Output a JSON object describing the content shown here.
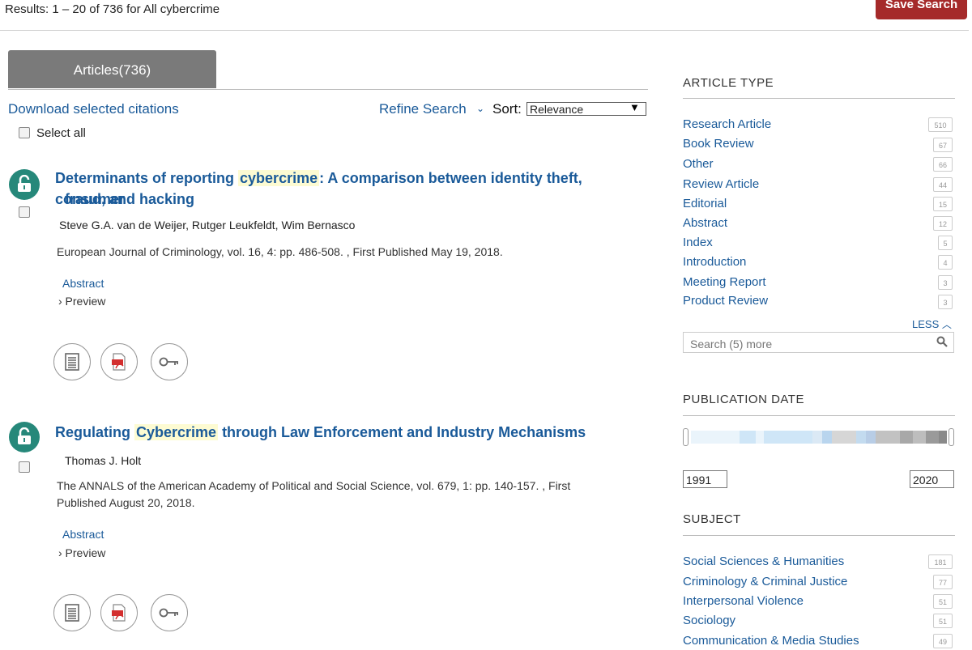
{
  "header": {
    "results_text": "Results: 1 – 20 of 736 for All cybercrime",
    "save_search_label": "Save Search"
  },
  "tabs": [
    {
      "label": "Articles(736)"
    }
  ],
  "toolbar": {
    "download_label": "Download selected citations",
    "refine_label": "Refine Search",
    "sort_label": "Sort:",
    "sort_value": "Relevance",
    "select_all_label": "Select all"
  },
  "results": [
    {
      "title_pre": "Determinants of reporting ",
      "title_hl": "cybercrime",
      "title_post": ": A comparison between identity theft, consumer",
      "title_line2": "fraud, and hacking",
      "authors": "Steve G.A. van de Weijer, Rutger Leukfeldt, Wim Bernasco",
      "journal_line1": "European Journal of Criminology, vol. 16, 4: pp. 486-508. , First Published May 19, 2018.",
      "journal_line2": "",
      "abstract_label": "Abstract",
      "preview_label": "› Preview"
    },
    {
      "title_pre": "Regulating ",
      "title_hl": "Cybercrime",
      "title_post": " through Law Enforcement and Industry Mechanisms",
      "title_line2": "",
      "authors": "Thomas J. Holt",
      "journal_line1": "The ANNALS of the American Academy of Political and Social Science, vol. 679, 1: pp. 140-157. , First",
      "journal_line2": "Published August 20, 2018.",
      "abstract_label": "Abstract",
      "preview_label": "› Preview"
    }
  ],
  "sidebar": {
    "article_type": {
      "heading": "ARTICLE TYPE",
      "items": [
        {
          "label": "Research Article",
          "count": "510"
        },
        {
          "label": "Book Review",
          "count": "67"
        },
        {
          "label": "Other",
          "count": "66"
        },
        {
          "label": "Review Article",
          "count": "44"
        },
        {
          "label": "Editorial",
          "count": "15"
        },
        {
          "label": "Abstract",
          "count": "12"
        },
        {
          "label": "Index",
          "count": "5"
        },
        {
          "label": "Introduction",
          "count": "4"
        },
        {
          "label": "Meeting Report",
          "count": "3"
        },
        {
          "label": "Product Review",
          "count": "3"
        }
      ],
      "less_label": "LESS",
      "search_placeholder": "Search (5) more"
    },
    "publication_date": {
      "heading": "PUBLICATION DATE",
      "from": "1991",
      "to": "2020"
    },
    "subject": {
      "heading": "SUBJECT",
      "items": [
        {
          "label": "Social Sciences & Humanities",
          "count": "181"
        },
        {
          "label": "Criminology & Criminal Justice",
          "count": "77"
        },
        {
          "label": "Interpersonal Violence",
          "count": "51"
        },
        {
          "label": "Sociology",
          "count": "51"
        },
        {
          "label": "Communication & Media Studies",
          "count": "49"
        }
      ]
    }
  },
  "colors": {
    "accent": "#a52a2a",
    "link": "#1a5a99",
    "lock": "#26887a",
    "highlight": "#fdfbd2"
  }
}
